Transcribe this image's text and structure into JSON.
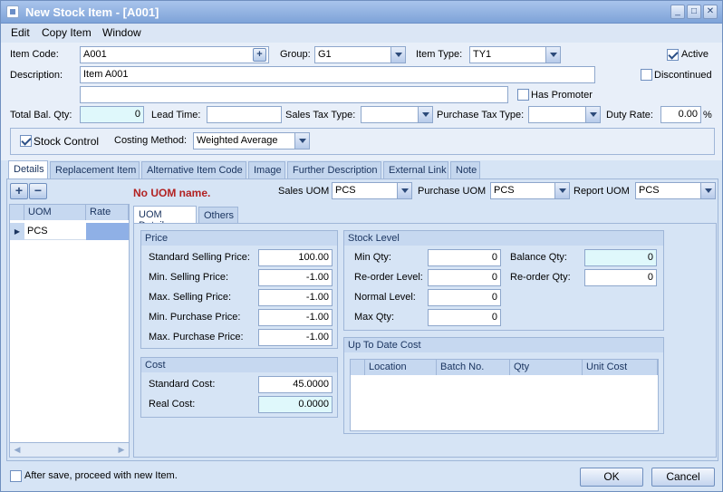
{
  "window": {
    "title": "New Stock Item - [A001]"
  },
  "menu": [
    "Edit",
    "Copy Item",
    "Window"
  ],
  "header": {
    "item_code_label": "Item Code:",
    "item_code": "A001",
    "group_label": "Group:",
    "group": "G1",
    "item_type_label": "Item Type:",
    "item_type": "TY1",
    "active_label": "Active",
    "active": true,
    "description_label": "Description:",
    "description": "Item A001",
    "description2": "",
    "discontinued_label": "Discontinued",
    "discontinued": false,
    "has_promoter_label": "Has Promoter",
    "has_promoter": false,
    "total_bal_qty_label": "Total Bal. Qty:",
    "total_bal_qty": "0",
    "lead_time_label": "Lead Time:",
    "lead_time": "",
    "sales_tax_type_label": "Sales Tax Type:",
    "sales_tax_type": "",
    "purchase_tax_type_label": "Purchase Tax Type:",
    "purchase_tax_type": "",
    "duty_rate_label": "Duty Rate:",
    "duty_rate": "0.00",
    "duty_rate_unit": "%",
    "stock_control_label": "Stock Control",
    "stock_control": true,
    "costing_method_label": "Costing Method:",
    "costing_method": "Weighted Average"
  },
  "tabs": [
    "Details",
    "Replacement Item",
    "Alternative Item Code",
    "Image",
    "Further Description",
    "External Link",
    "Note"
  ],
  "uom_grid": {
    "columns": [
      "UOM",
      "Rate"
    ],
    "rows": [
      {
        "uom": "PCS",
        "rate": ""
      }
    ]
  },
  "warning": "No UOM name.",
  "uom_selects": {
    "sales_label": "Sales UOM",
    "sales": "PCS",
    "purchase_label": "Purchase UOM",
    "purchase": "PCS",
    "report_label": "Report UOM",
    "report": "PCS"
  },
  "subtabs": [
    "UOM Details",
    "Others"
  ],
  "price": {
    "title": "Price",
    "std_sell_label": "Standard Selling Price:",
    "std_sell": "100.00",
    "min_sell_label": "Min. Selling Price:",
    "min_sell": "-1.00",
    "max_sell_label": "Max. Selling Price:",
    "max_sell": "-1.00",
    "min_purch_label": "Min. Purchase Price:",
    "min_purch": "-1.00",
    "max_purch_label": "Max. Purchase Price:",
    "max_purch": "-1.00"
  },
  "cost": {
    "title": "Cost",
    "std_cost_label": "Standard Cost:",
    "std_cost": "45.0000",
    "real_cost_label": "Real Cost:",
    "real_cost": "0.0000"
  },
  "stock_level": {
    "title": "Stock Level",
    "min_qty_label": "Min Qty:",
    "min_qty": "0",
    "reorder_level_label": "Re-order Level:",
    "reorder_level": "0",
    "normal_level_label": "Normal Level:",
    "normal_level": "0",
    "max_qty_label": "Max Qty:",
    "max_qty": "0",
    "balance_qty_label": "Balance Qty:",
    "balance_qty": "0",
    "reorder_qty_label": "Re-order Qty:",
    "reorder_qty": "0"
  },
  "up_to_date_cost": {
    "title": "Up To Date Cost",
    "columns": [
      "Location",
      "Batch No.",
      "Qty",
      "Unit Cost"
    ]
  },
  "footer": {
    "after_save_label": "After save, proceed with new Item.",
    "after_save": false,
    "ok": "OK",
    "cancel": "Cancel"
  },
  "colors": {
    "accent": "#7ea3d8",
    "warning": "#b22222",
    "highlight": "#dff8fb"
  }
}
